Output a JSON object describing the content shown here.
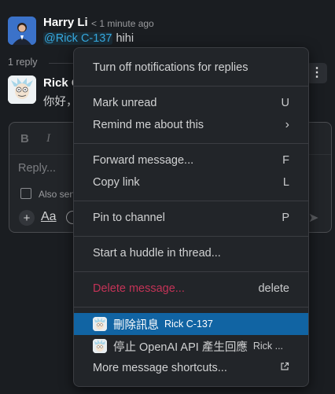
{
  "message": {
    "author": "Harry Li",
    "timestamp": "< 1 minute ago",
    "mention": "@Rick C-137",
    "text": "hihi"
  },
  "thread": {
    "reply_count": "1 reply"
  },
  "reply": {
    "author": "Rick C",
    "text": "你好，"
  },
  "composer": {
    "placeholder": "Reply...",
    "also_send": "Also sen"
  },
  "menu": {
    "items": [
      {
        "label": "Turn off notifications for replies",
        "key": ""
      },
      {
        "label": "Mark unread",
        "key": "U"
      },
      {
        "label": "Remind me about this",
        "key": "›"
      },
      {
        "label": "Forward message...",
        "key": "F"
      },
      {
        "label": "Copy link",
        "key": "L"
      },
      {
        "label": "Pin to channel",
        "key": "P"
      },
      {
        "label": "Start a huddle in thread...",
        "key": ""
      },
      {
        "label": "Delete message...",
        "key": "delete"
      },
      {
        "label": "刪除訊息",
        "sub": "Rick C-137"
      },
      {
        "label": "停止 OpenAI API 產生回應",
        "sub": "Rick ..."
      },
      {
        "label": "More message shortcuts...",
        "key": "external-link-icon"
      }
    ]
  },
  "colors": {
    "background": "#1a1d21",
    "menu_bg": "#222529",
    "selected": "#1164a3",
    "danger": "#c43357",
    "mention": "#36a9e0"
  }
}
